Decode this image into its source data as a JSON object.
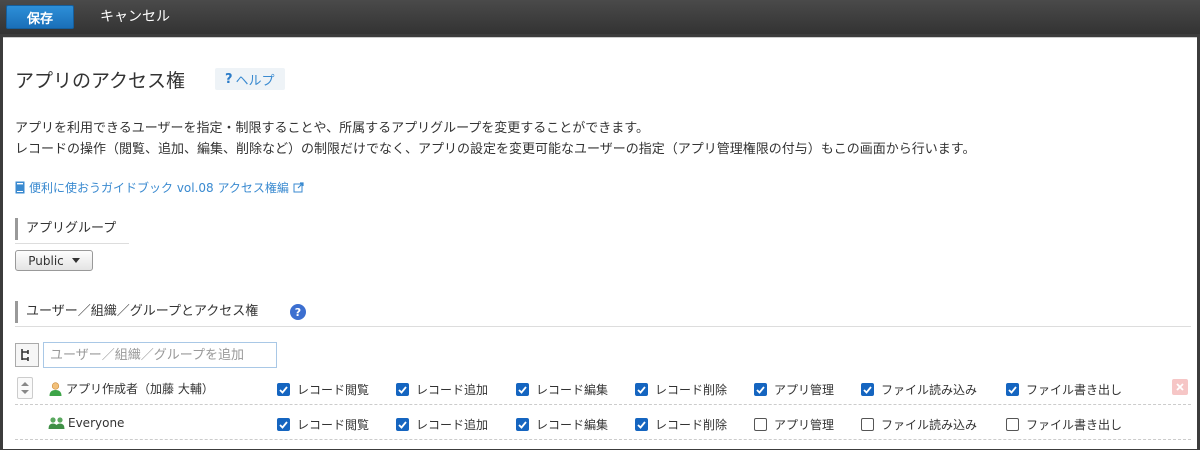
{
  "toolbar": {
    "save_label": "保存",
    "cancel_label": "キャンセル"
  },
  "page": {
    "title": "アプリのアクセス権",
    "help_label": "ヘルプ",
    "description_line1": "アプリを利用できるユーザーを指定・制限することや、所属するアプリグループを変更することができます。",
    "description_line2": "レコードの操作（閲覧、追加、編集、削除など）の制限だけでなく、アプリの設定を変更可能なユーザーの指定（アプリ管理権限の付与）もこの画面から行います。",
    "guide_link": "便利に使おうガイドブック vol.08 アクセス権編"
  },
  "app_group": {
    "heading": "アプリグループ",
    "selected": "Public"
  },
  "access": {
    "heading": "ユーザー／組織／グループとアクセス権",
    "add_placeholder": "ユーザー／組織／グループを追加",
    "permission_labels": [
      "レコード閲覧",
      "レコード追加",
      "レコード編集",
      "レコード削除",
      "アプリ管理",
      "ファイル読み込み",
      "ファイル書き出し"
    ],
    "rows": [
      {
        "name": "アプリ作成者（加藤 大輔）",
        "icon": "user-icon",
        "checked": [
          true,
          true,
          true,
          true,
          true,
          true,
          true
        ]
      },
      {
        "name": "Everyone",
        "icon": "group-icon",
        "checked": [
          true,
          true,
          true,
          true,
          false,
          false,
          false
        ]
      }
    ]
  },
  "colors": {
    "save_button": "#1a6fb8",
    "link": "#3a8ad0",
    "checkbox": "#1565c0"
  }
}
